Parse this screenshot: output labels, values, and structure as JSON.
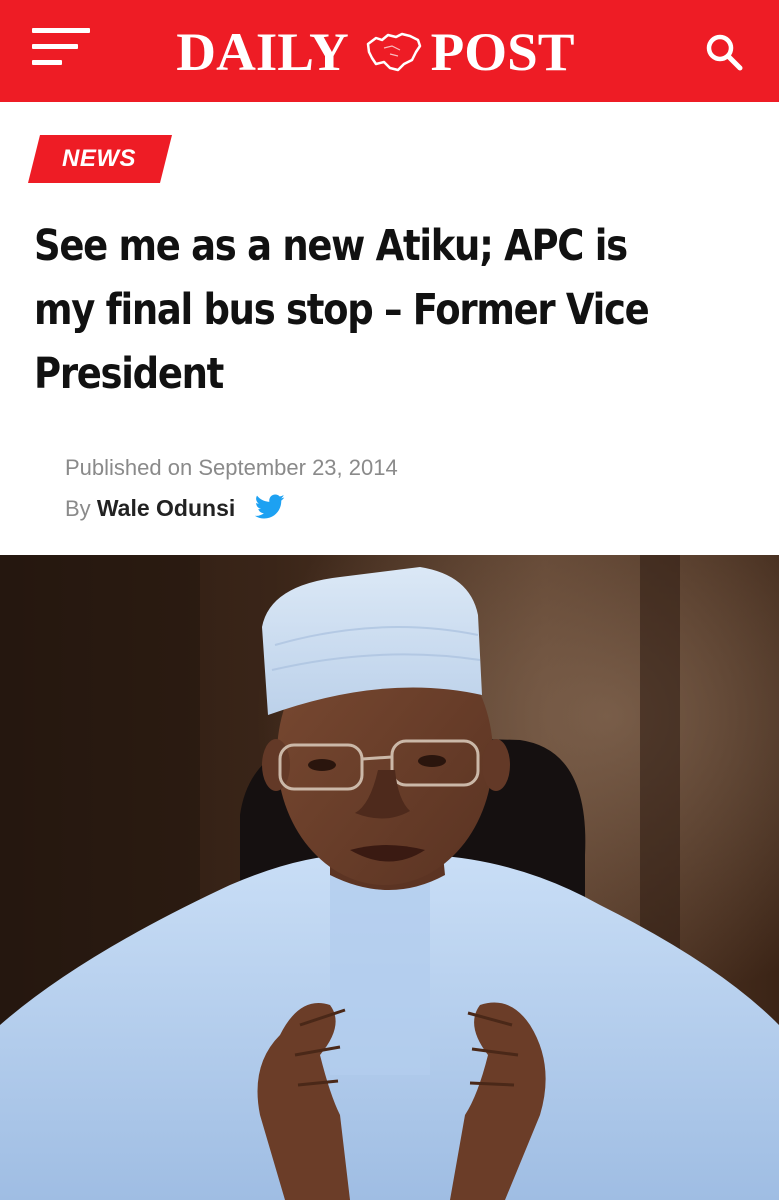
{
  "header": {
    "brand": {
      "left_word": "DAILY",
      "right_word": "POST"
    },
    "menu_icon": "hamburger-menu-icon",
    "search_icon": "search-icon",
    "colors": {
      "bar": "#ee1c25",
      "foreground": "#ffffff"
    }
  },
  "article": {
    "category": "NEWS",
    "category_color": "#ee1c25",
    "headline": "See me as a new Atiku; APC is my final bus stop – Former Vice President",
    "published_prefix": "Published on",
    "published_date": "September 23, 2014",
    "byline_prefix": "By",
    "author": "Wale Odunsi",
    "social_icon": "twitter-bird-icon",
    "twitter_color": "#1da1f2"
  }
}
